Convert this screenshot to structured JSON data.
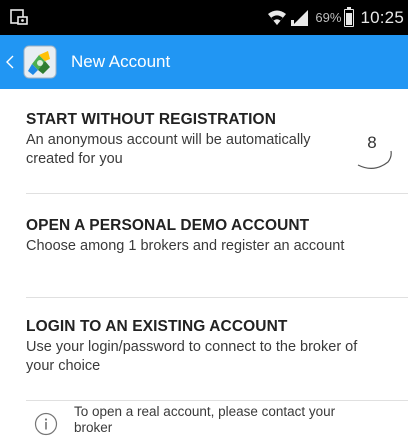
{
  "status_bar": {
    "battery_percent_label": "69%",
    "battery_level": 0.69,
    "time": "10:25",
    "icons": [
      "notification-icon",
      "wifi-icon",
      "signal-icon",
      "battery-icon"
    ]
  },
  "app_bar": {
    "title": "New Account",
    "background_color": "#2196f3",
    "icons": [
      "back-chevron-icon",
      "app-logo-icon"
    ]
  },
  "options": [
    {
      "title": "START WITHOUT REGISTRATION",
      "description": "An anonymous account will be automatically created for you",
      "countdown": "8"
    },
    {
      "title": "OPEN A PERSONAL DEMO ACCOUNT",
      "description": "Choose among 1 brokers and register an account"
    },
    {
      "title": "LOGIN TO AN EXISTING ACCOUNT",
      "description": "Use your login/password to connect to the broker of your choice"
    }
  ],
  "info": {
    "text": "To open a real account, please contact your broker",
    "icon": "info-icon"
  }
}
